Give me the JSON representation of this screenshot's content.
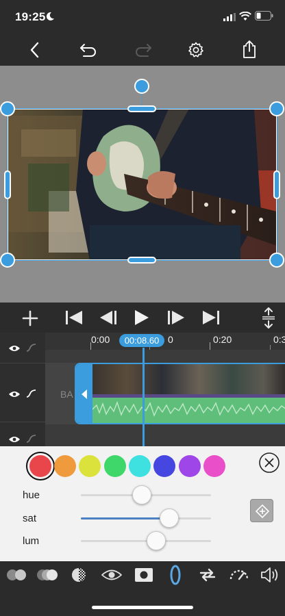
{
  "status": {
    "time": "19:25"
  },
  "toolbar": {
    "icons": [
      "back-icon",
      "undo-icon",
      "redo-icon",
      "settings-icon",
      "share-icon"
    ]
  },
  "timeline": {
    "timecode": "00:08.60",
    "ruler_labels": [
      "0:00",
      "0",
      "0:20",
      "0:3"
    ],
    "clip_label": "BA"
  },
  "color_panel": {
    "swatches": [
      "#e8464b",
      "#f09a3e",
      "#dbe23b",
      "#3fd66a",
      "#3fe0e0",
      "#4646e0",
      "#9e46e8",
      "#e94fc8"
    ],
    "selected_swatch": 0,
    "hue_label": "hue",
    "sat_label": "sat",
    "lum_label": "lum",
    "hue_value": 0.47,
    "sat_value": 0.68,
    "lum_value": 0.58
  },
  "tools": {
    "icons": [
      "blend-icon",
      "overlay-icon",
      "gradient-icon",
      "eye-icon",
      "mask-icon",
      "shape-icon",
      "loop-icon",
      "speed-icon",
      "volume-icon"
    ],
    "active": "shape-icon"
  }
}
